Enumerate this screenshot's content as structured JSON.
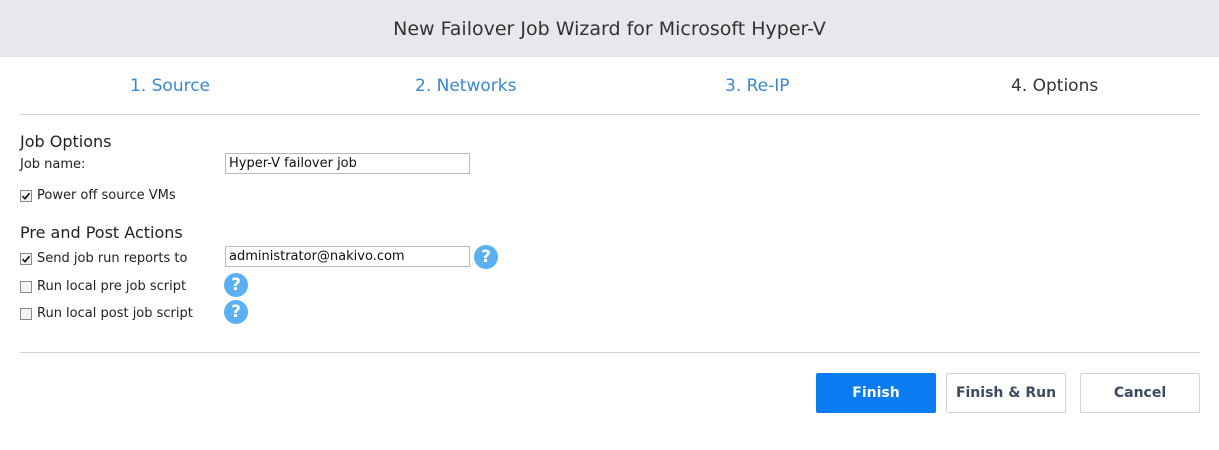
{
  "window": {
    "title": "New Failover Job Wizard for Microsoft Hyper-V"
  },
  "steps": [
    {
      "label": "1. Source",
      "state": "link"
    },
    {
      "label": "2. Networks",
      "state": "link"
    },
    {
      "label": "3. Re-IP",
      "state": "link"
    },
    {
      "label": "4. Options",
      "state": "current"
    }
  ],
  "job_options": {
    "title": "Job Options",
    "job_name_label": "Job name:",
    "job_name_value": "Hyper-V failover job",
    "power_off_label": "Power off source VMs",
    "power_off_checked": true
  },
  "pre_post": {
    "title": "Pre and Post Actions",
    "send_reports_label": "Send job run reports to",
    "send_reports_checked": true,
    "send_reports_value": "administrator@nakivo.com",
    "pre_script_label": "Run local pre job script",
    "pre_script_checked": false,
    "post_script_label": "Run local post job script",
    "post_script_checked": false,
    "help_glyph": "?"
  },
  "buttons": {
    "finish": "Finish",
    "finish_run": "Finish & Run",
    "cancel": "Cancel"
  },
  "colors": {
    "header_bg": "#e6e8ec",
    "step_link": "#3a87d6",
    "help_icon": "#5ab0f2",
    "primary_button": "#0a7bf0"
  }
}
